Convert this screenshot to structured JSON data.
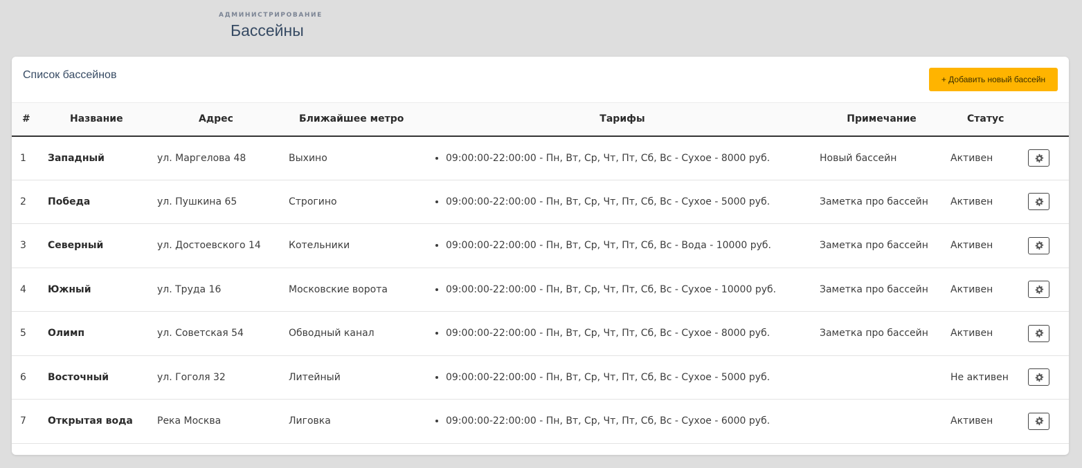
{
  "header": {
    "breadcrumb": "Администрирование",
    "title": "Бассейны"
  },
  "card": {
    "title": "Список бассейнов",
    "add_button_label": "+ Добавить новый бассейн"
  },
  "table": {
    "columns": [
      "#",
      "Название",
      "Адрес",
      "Ближайшее метро",
      "Тарифы",
      "Примечание",
      "Статус",
      ""
    ],
    "rows": [
      {
        "num": "1",
        "name": "Западный",
        "address": "ул. Маргелова 48",
        "metro": "Выхино",
        "tariff": "09:00:00-22:00:00 - Пн, Вт, Ср, Чт, Пт, Сб, Вс - Сухое - 8000 руб.",
        "note": "Новый бассейн",
        "status": "Активен"
      },
      {
        "num": "2",
        "name": "Победа",
        "address": "ул. Пушкина 65",
        "metro": "Строгино",
        "tariff": "09:00:00-22:00:00 - Пн, Вт, Ср, Чт, Пт, Сб, Вс - Сухое - 5000 руб.",
        "note": "Заметка про бассейн",
        "status": "Активен"
      },
      {
        "num": "3",
        "name": "Северный",
        "address": "ул. Достоевского 14",
        "metro": "Котельники",
        "tariff": "09:00:00-22:00:00 - Пн, Вт, Ср, Чт, Пт, Сб, Вс - Вода - 10000 руб.",
        "note": "Заметка про бассейн",
        "status": "Активен"
      },
      {
        "num": "4",
        "name": "Южный",
        "address": "ул. Труда 16",
        "metro": "Московские ворота",
        "tariff": "09:00:00-22:00:00 - Пн, Вт, Ср, Чт, Пт, Сб, Вс - Сухое - 10000 руб.",
        "note": "Заметка про бассейн",
        "status": "Активен"
      },
      {
        "num": "5",
        "name": "Олимп",
        "address": "ул. Советская 54",
        "metro": "Обводный канал",
        "tariff": "09:00:00-22:00:00 - Пн, Вт, Ср, Чт, Пт, Сб, Вс - Сухое - 8000 руб.",
        "note": "Заметка про бассейн",
        "status": "Активен"
      },
      {
        "num": "6",
        "name": "Восточный",
        "address": "ул. Гоголя 32",
        "metro": "Литейный",
        "tariff": "09:00:00-22:00:00 - Пн, Вт, Ср, Чт, Пт, Сб, Вс - Сухое - 5000 руб.",
        "note": "",
        "status": "Не активен"
      },
      {
        "num": "7",
        "name": "Открытая вода",
        "address": "Река Москва",
        "metro": "Лиговка",
        "tariff": "09:00:00-22:00:00 - Пн, Вт, Ср, Чт, Пт, Сб, Вс - Сухое - 6000 руб.",
        "note": "",
        "status": "Активен"
      }
    ]
  },
  "icons": {
    "row_action": "gear-icon"
  },
  "colors": {
    "accent": "#ffb400",
    "title": "#364a63",
    "background": "#dedede"
  }
}
